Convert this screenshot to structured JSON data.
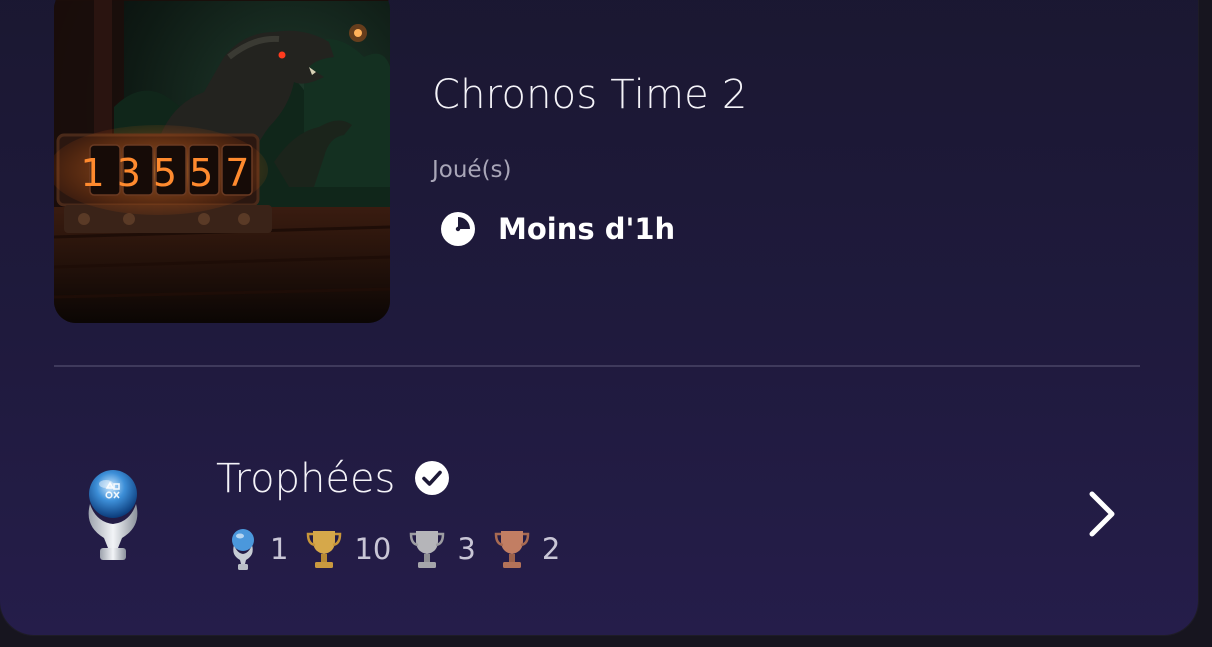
{
  "game": {
    "title": "Chronos Time 2",
    "cover_counter_digits": "13557",
    "played_label": "Joué(s)",
    "playtime": "Moins d'1h"
  },
  "trophies": {
    "title": "Trophées",
    "counts": [
      {
        "type": "platinum",
        "icon": "platinum-trophy-icon",
        "value": "1",
        "color": "#9fc6e8"
      },
      {
        "type": "gold",
        "icon": "gold-trophy-icon",
        "value": "10",
        "color": "#d6a84a"
      },
      {
        "type": "silver",
        "icon": "silver-trophy-icon",
        "value": "3",
        "color": "#b5b5b9"
      },
      {
        "type": "bronze",
        "icon": "bronze-trophy-icon",
        "value": "2",
        "color": "#c27e63"
      }
    ]
  },
  "colors": {
    "accent_glow": "#ff7a2a",
    "text_muted": "#a9a6b8"
  }
}
